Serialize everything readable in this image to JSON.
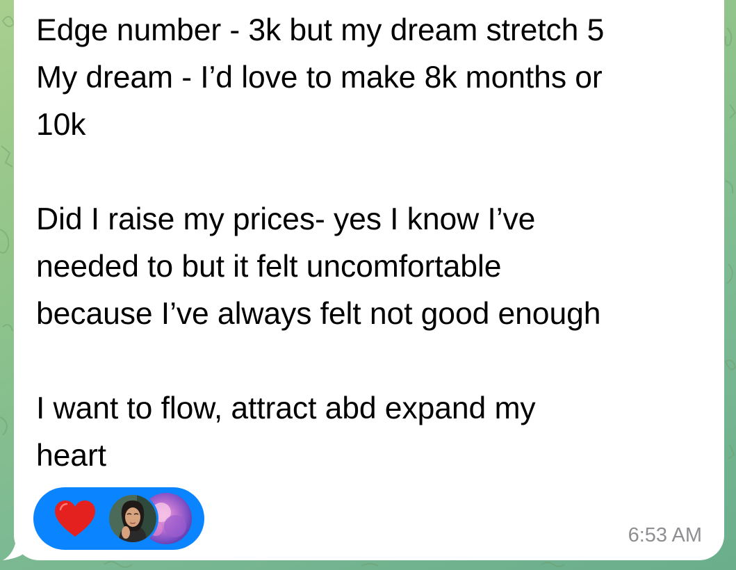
{
  "message": {
    "text": "Edge number - 3k but my dream stretch 5\nMy dream - I’d love to make 8k months or\n10k\n\nDid I raise my prices- yes I know I’ve\nneeded to but it felt uncomfortable\nbecause I’ve always felt not good enough\n\nI want to flow, attract abd expand my\nheart",
    "time": "6:53 AM"
  },
  "reaction": {
    "emoji_icon": "red-heart-icon",
    "reactor_count": 2
  },
  "colors": {
    "bubble": "#ffffff",
    "reaction_pill": "#0a84ff",
    "heart": "#e5211f",
    "timestamp": "#8e8e93",
    "wallpaper": "#8fc38a"
  }
}
